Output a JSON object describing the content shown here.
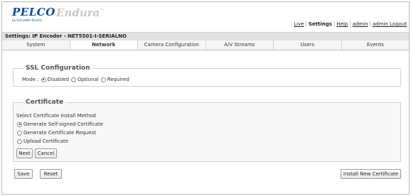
{
  "header": {
    "brand": "PELCO",
    "brand_sub": "by Schneider Electric",
    "product": "Endura",
    "trademark": "™"
  },
  "topnav": {
    "live": "Live",
    "settings": "Settings",
    "help": "Help",
    "admin": "admin",
    "logout": "admin Logout"
  },
  "settings_bar": "Settings: IP Encoder - NET5501-I-SERIALNO",
  "tabs": [
    "System",
    "Network",
    "Camera Configuration",
    "A/V Streams",
    "Users",
    "Events"
  ],
  "ssl": {
    "title": "SSL Configuration",
    "mode_label": "Mode :",
    "options": [
      "Disabled",
      "Optional",
      "Required"
    ],
    "selected": "Disabled"
  },
  "certificate": {
    "title": "Certificate",
    "method_label": "Select Certificate Install Method",
    "options": [
      "Generate Self-signed Certificate",
      "Generate Certificate Request",
      "Upload Certificate"
    ],
    "selected": "Generate Self-signed Certificate",
    "next_label": "Next",
    "cancel_label": "Cancel"
  },
  "footer": {
    "save_label": "Save",
    "reset_label": "Reset",
    "install_label": "Install New Certificate"
  }
}
